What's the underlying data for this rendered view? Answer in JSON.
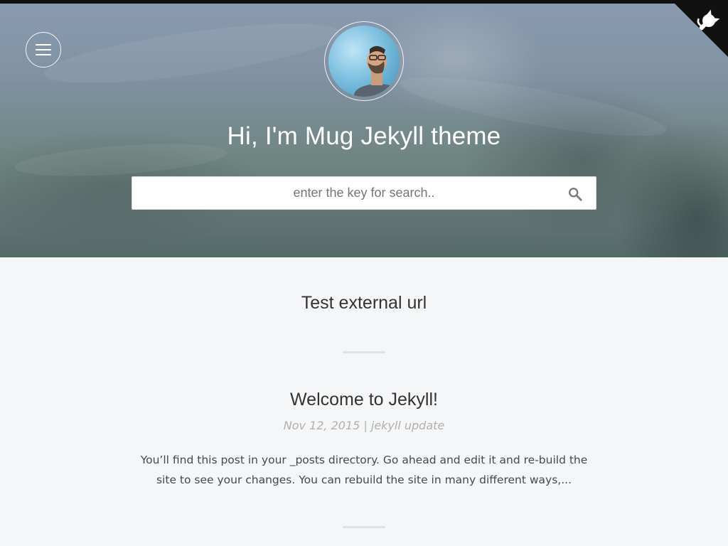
{
  "header": {
    "title": "Hi, I'm Mug Jekyll theme",
    "menu_icon": "hamburger-menu-icon",
    "corner_icon": "github-octocat-icon"
  },
  "search": {
    "placeholder": "enter the key for search..",
    "icon": "search-icon"
  },
  "main": {
    "section_title": "Test external url",
    "posts": [
      {
        "title": "Welcome to Jekyll!",
        "meta": "Nov 12, 2015 | jekyll update",
        "excerpt": "You’ll find this post in your _posts directory. Go ahead and edit it and re-build the site to see your changes. You can rebuild the site in many different ways,..."
      }
    ]
  },
  "colors": {
    "page_background": "#f4f6f8",
    "hero_top": "#8a9bb0",
    "hero_bottom": "#55696a",
    "text": "#333333",
    "meta": "#b0b0b0"
  }
}
